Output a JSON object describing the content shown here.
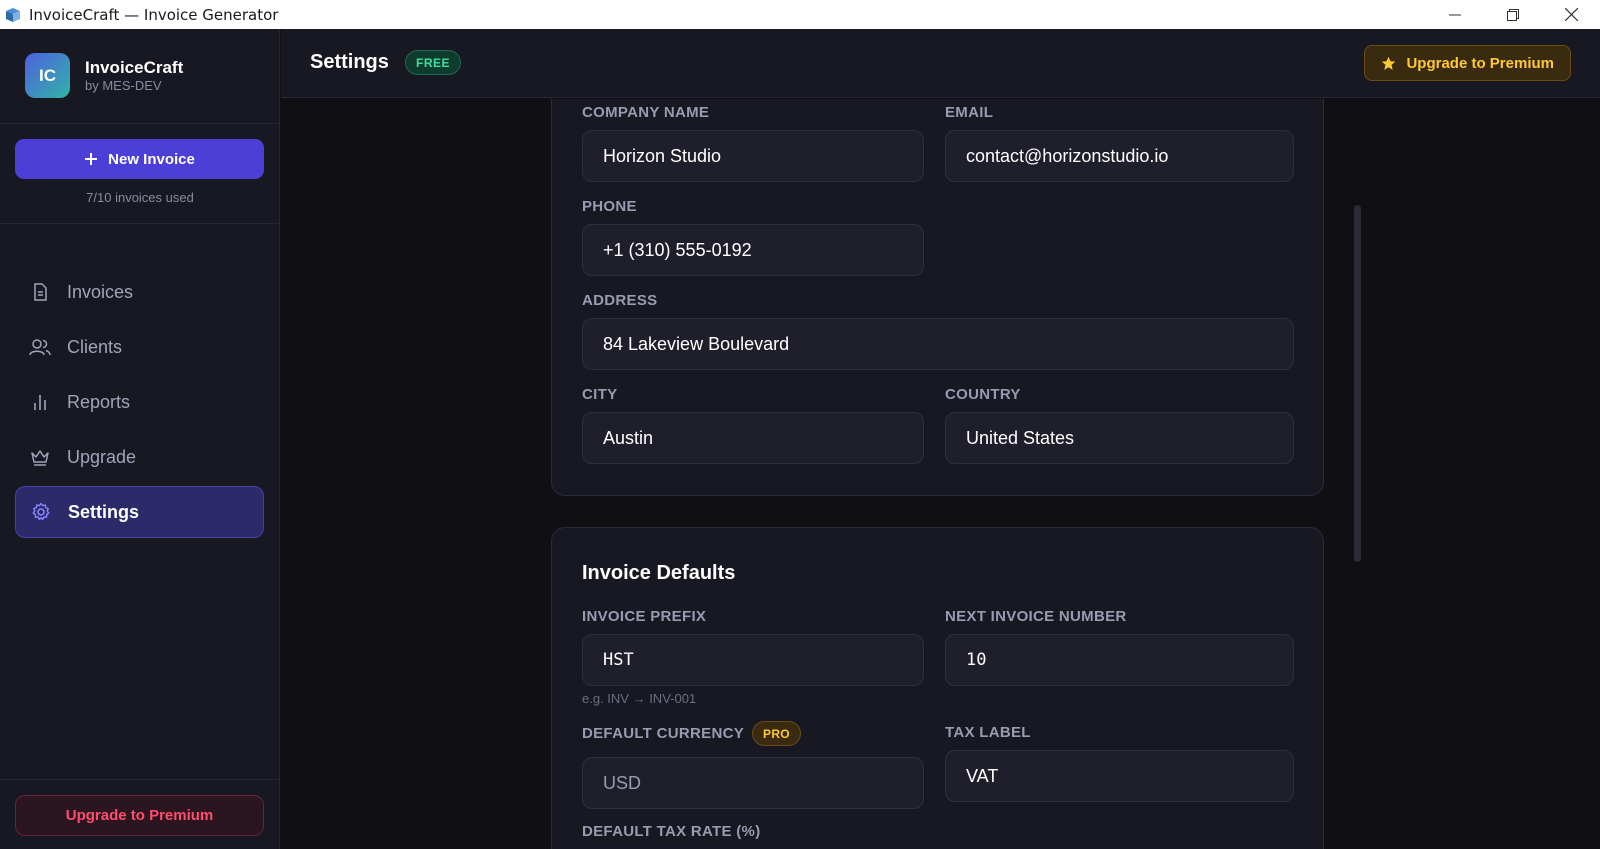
{
  "window": {
    "title": "InvoiceCraft — Invoice Generator"
  },
  "sidebar": {
    "logo_initials": "IC",
    "brand_name": "InvoiceCraft",
    "brand_sub": "by MES-DEV",
    "new_invoice_label": "New Invoice",
    "usage_text": "7/10 invoices used",
    "items": [
      {
        "label": "Invoices",
        "icon": "document-icon",
        "active": false
      },
      {
        "label": "Clients",
        "icon": "users-icon",
        "active": false
      },
      {
        "label": "Reports",
        "icon": "bar-chart-icon",
        "active": false
      },
      {
        "label": "Upgrade",
        "icon": "crown-icon",
        "active": false
      },
      {
        "label": "Settings",
        "icon": "gear-icon",
        "active": true
      }
    ],
    "upgrade_label": "Upgrade to Premium"
  },
  "header": {
    "title": "Settings",
    "plan_badge": "FREE",
    "upgrade_label": "Upgrade to Premium"
  },
  "company": {
    "company_name_label": "COMPANY NAME",
    "company_name_value": "Horizon Studio",
    "email_label": "EMAIL",
    "email_value": "contact@horizonstudio.io",
    "phone_label": "PHONE",
    "phone_value": "+1 (310) 555-0192",
    "address_label": "ADDRESS",
    "address_value": "84 Lakeview Boulevard",
    "city_label": "CITY",
    "city_value": "Austin",
    "country_label": "COUNTRY",
    "country_value": "United States"
  },
  "invoice_defaults": {
    "title": "Invoice Defaults",
    "prefix_label": "INVOICE PREFIX",
    "prefix_value": "HST",
    "prefix_hint": "e.g. INV → INV-001",
    "next_number_label": "NEXT INVOICE NUMBER",
    "next_number_value": "10",
    "currency_label": "DEFAULT CURRENCY",
    "currency_badge": "PRO",
    "currency_value": "USD",
    "tax_label_label": "TAX LABEL",
    "tax_label_value": "VAT",
    "tax_rate_label": "DEFAULT TAX RATE (%)"
  },
  "colors": {
    "accent": "#4b3fd8",
    "free_badge": "#3ee0a0",
    "premium": "#ffc933",
    "danger": "#ff4d6d"
  }
}
